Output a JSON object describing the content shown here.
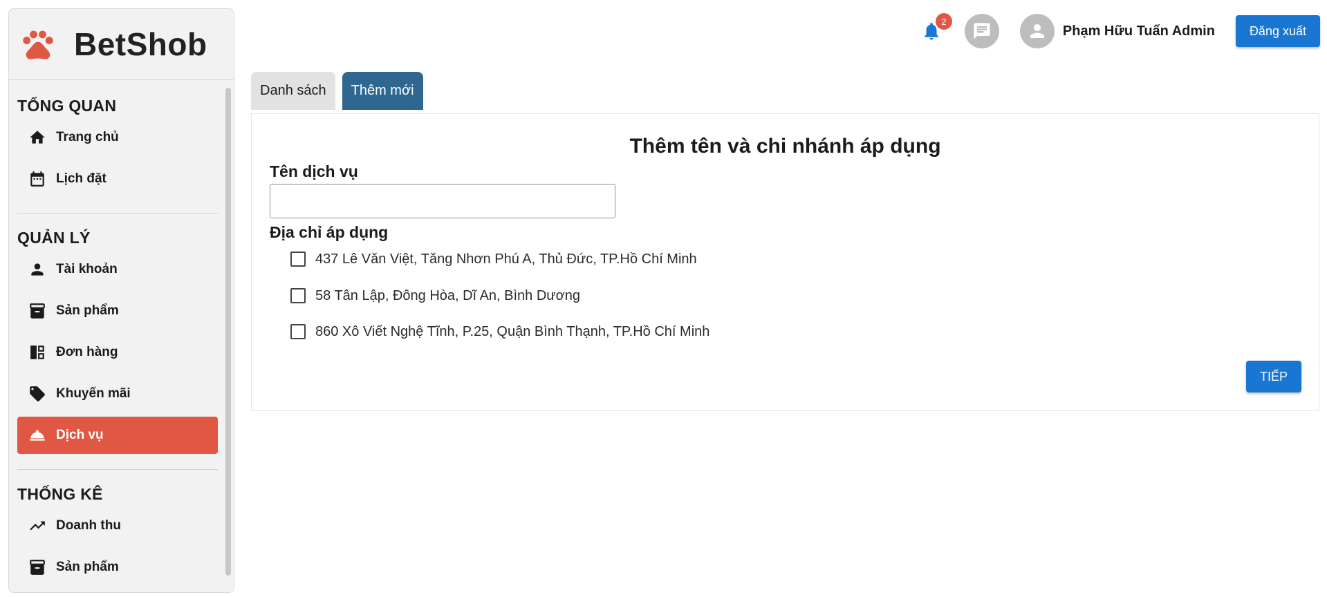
{
  "brand": {
    "name": "BetShob",
    "logo_icon": "paw-icon",
    "color": "#e05744"
  },
  "sidebar": {
    "sections": [
      {
        "title": "TỔNG QUAN",
        "items": [
          {
            "label": "Trang chủ",
            "icon": "home-icon"
          },
          {
            "label": "Lịch đặt",
            "icon": "calendar-icon"
          }
        ]
      },
      {
        "title": "QUẢN LÝ",
        "items": [
          {
            "label": "Tài khoản",
            "icon": "person-icon"
          },
          {
            "label": "Sản phẩm",
            "icon": "archive-icon"
          },
          {
            "label": "Đơn hàng",
            "icon": "dashboard-icon"
          },
          {
            "label": "Khuyến mãi",
            "icon": "tag-icon"
          },
          {
            "label": "Dịch vụ",
            "icon": "room-service-icon",
            "active": true
          }
        ]
      },
      {
        "title": "THỐNG KÊ",
        "items": [
          {
            "label": "Doanh thu",
            "icon": "trending-up-icon"
          },
          {
            "label": "Sản phẩm",
            "icon": "archive-icon"
          }
        ]
      }
    ]
  },
  "header": {
    "notification_count": "2",
    "user_name": "Phạm Hữu Tuấn Admin",
    "logout_label": "Đăng xuất"
  },
  "tabs": [
    {
      "label": "Danh sách",
      "active": false
    },
    {
      "label": "Thêm mới",
      "active": true
    }
  ],
  "form": {
    "title": "Thêm tên và chi nhánh áp dụng",
    "name_label": "Tên dịch vụ",
    "name_value": "",
    "address_label": "Địa chỉ áp dụng",
    "addresses": [
      {
        "text": "437 Lê Văn Việt, Tăng Nhơn Phú A, Thủ Đức, TP.Hồ Chí Minh",
        "checked": false
      },
      {
        "text": "58 Tân Lập, Đông Hòa, Dĩ An, Bình Dương",
        "checked": false
      },
      {
        "text": "860 Xô Viết Nghệ Tĩnh, P.25, Quận Bình Thạnh, TP.Hồ Chí Minh",
        "checked": false
      }
    ],
    "next_label": "TIẾP"
  },
  "colors": {
    "accent_red": "#e05744",
    "primary_blue": "#1976d2",
    "active_tab": "#2f6790",
    "bell_blue": "#1976d2"
  }
}
